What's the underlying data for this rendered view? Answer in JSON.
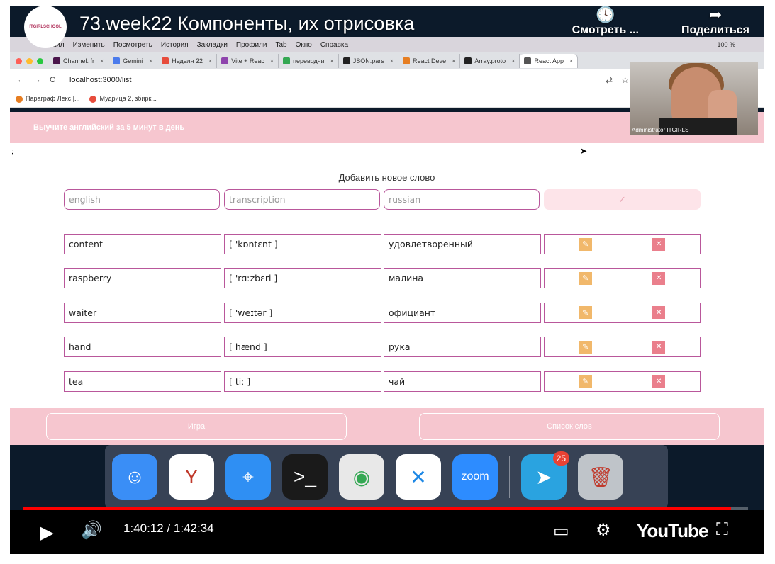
{
  "video": {
    "title": "73.week22 Компоненты, их отрисовка",
    "channel_logo_text": "ITGIRLSCHOOL",
    "watch_later": "Смотреть ...",
    "share": "Поделиться",
    "time": "1:40:12 / 1:42:34",
    "progress": 0.977,
    "youtube": "YouTube"
  },
  "mac_menu": {
    "items": [
      "Файл",
      "Изменить",
      "Посмотреть",
      "История",
      "Закладки",
      "Профили",
      "Tab",
      "Окно",
      "Справка"
    ],
    "status": "100 %"
  },
  "tabs": [
    {
      "label": "Channel: fr",
      "color": "#4a154b"
    },
    {
      "label": "Gemini",
      "color": "#4b7bec"
    },
    {
      "label": "Неделя 22",
      "color": "#e74c3c"
    },
    {
      "label": "Vite + Reac",
      "color": "#8e44ad"
    },
    {
      "label": "переводчи",
      "color": "#34a853"
    },
    {
      "label": "JSON.pars",
      "color": "#222222"
    },
    {
      "label": "React Deve",
      "color": "#e67e22"
    },
    {
      "label": "Array.proto",
      "color": "#222222"
    },
    {
      "label": "React App",
      "color": "#555555"
    }
  ],
  "address": "localhost:3000/list",
  "bookmarks": [
    "Параграф Лекс |...",
    "Мудрица 2, збирк..."
  ],
  "webcam_label": "Administrator ITGIRLS",
  "app": {
    "header": "Выучите английский за 5 минут в день",
    "semicolon": ";",
    "add_title": "Добавить новое слово",
    "placeholders": {
      "english": "english",
      "transcription": "transcription",
      "russian": "russian"
    },
    "confirm_icon": "✓",
    "words": [
      {
        "english": "content",
        "transcription": "[ 'kɒntɛnt ]",
        "russian": "удовлетворенный"
      },
      {
        "english": "raspberry",
        "transcription": "[ 'rɑːzbɛri ]",
        "russian": "малина"
      },
      {
        "english": "waiter",
        "transcription": "[ 'weɪtər ]",
        "russian": "официант"
      },
      {
        "english": "hand",
        "transcription": "[ hænd ]",
        "russian": "рука"
      },
      {
        "english": "tea",
        "transcription": "[ tiː ]",
        "russian": "чай"
      }
    ],
    "footer": {
      "game": "Игра",
      "list": "Список слов"
    }
  },
  "dock": [
    {
      "name": "finder",
      "color": "#3a8ef6",
      "glyph": "☺"
    },
    {
      "name": "yandex",
      "color": "#ffffff",
      "glyph": "Y"
    },
    {
      "name": "safari",
      "color": "#2f8ff3",
      "glyph": "⌖"
    },
    {
      "name": "terminal",
      "color": "#1a1a1a",
      "glyph": ">_"
    },
    {
      "name": "chrome",
      "color": "#e8e8e8",
      "glyph": "◉"
    },
    {
      "name": "vscode",
      "color": "#ffffff",
      "glyph": "✕"
    },
    {
      "name": "zoom",
      "color": "#2d8cff",
      "glyph": "zoom"
    },
    {
      "name": "telegram",
      "color": "#2aa3e0",
      "glyph": "➤",
      "badge": "25"
    },
    {
      "name": "trash",
      "color": "#bfc4c9",
      "glyph": "🗑"
    }
  ]
}
